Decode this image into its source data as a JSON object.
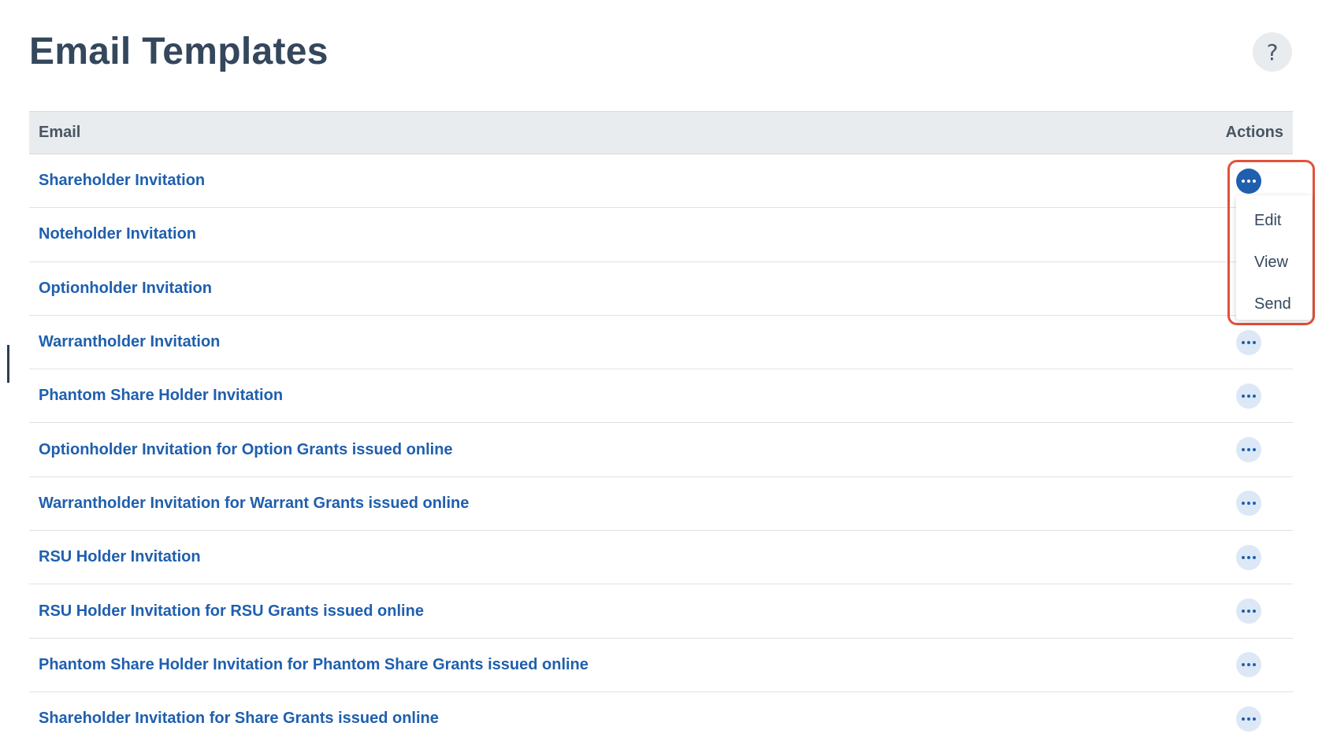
{
  "page": {
    "title": "Email Templates",
    "help_label": "?"
  },
  "table": {
    "columns": {
      "email": "Email",
      "actions": "Actions"
    },
    "rows": [
      {
        "name": "Shareholder Invitation",
        "menu_open": true
      },
      {
        "name": "Noteholder Invitation",
        "menu_open": false
      },
      {
        "name": "Optionholder Invitation",
        "menu_open": false
      },
      {
        "name": "Warrantholder Invitation",
        "menu_open": false
      },
      {
        "name": "Phantom Share Holder Invitation",
        "menu_open": false
      },
      {
        "name": "Optionholder Invitation for Option Grants issued online",
        "menu_open": false
      },
      {
        "name": "Warrantholder Invitation for Warrant Grants issued online",
        "menu_open": false
      },
      {
        "name": "RSU Holder Invitation",
        "menu_open": false
      },
      {
        "name": "RSU Holder Invitation for RSU Grants issued online",
        "menu_open": false
      },
      {
        "name": "Phantom Share Holder Invitation for Phantom Share Grants issued online",
        "menu_open": false
      },
      {
        "name": "Shareholder Invitation for Share Grants issued online",
        "menu_open": false
      }
    ]
  },
  "dropdown": {
    "items": [
      "Edit",
      "View",
      "Send"
    ]
  },
  "colors": {
    "link": "#1f5fae",
    "highlight": "#e2513b",
    "header_bg": "#e8ecef"
  }
}
